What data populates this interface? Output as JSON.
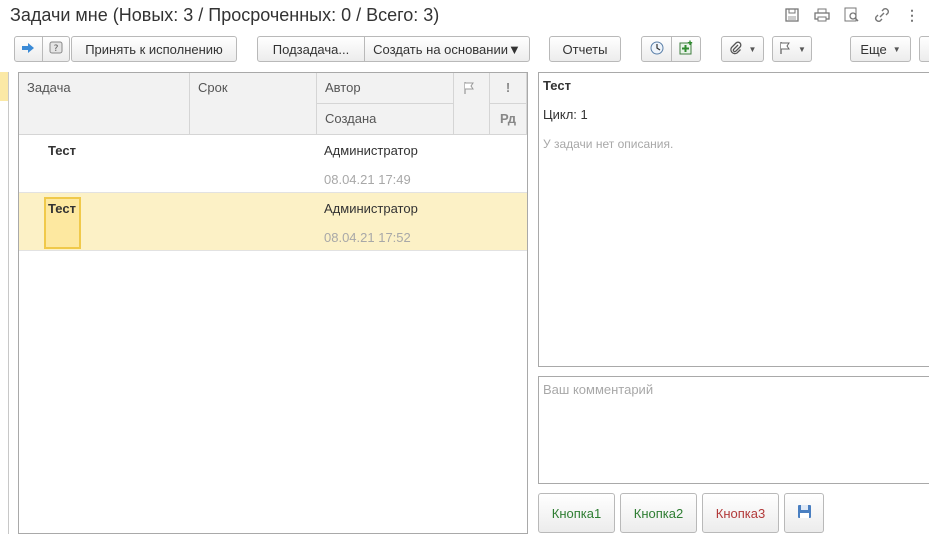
{
  "window": {
    "title": "Задачи мне (Новых: 3 / Просроченных: 0 / Всего: 3)"
  },
  "toolbar": {
    "accept_label": "Принять к исполнению",
    "subtask_label": "Подзадача...",
    "create_based_label": "Создать на основании",
    "reports_label": "Отчеты",
    "more_label": "Еще"
  },
  "table": {
    "headers": {
      "task": "Задача",
      "deadline": "Срок",
      "author": "Автор",
      "created": "Создана",
      "importance": "!",
      "rd": "Рд"
    },
    "rows": [
      {
        "task": "Тест",
        "deadline": "",
        "author": "Администратор",
        "created": "08.04.21 17:49"
      },
      {
        "task": "Тест",
        "deadline": "",
        "author": "Администратор",
        "created": "08.04.21 17:52"
      }
    ]
  },
  "details": {
    "title": "Тест",
    "cycle_label": "Цикл:",
    "cycle_value": "1",
    "no_description": "У задачи нет описания."
  },
  "comment": {
    "placeholder": "Ваш комментарий"
  },
  "action_buttons": [
    {
      "label": "Кнопка1",
      "color": "#2e7d32"
    },
    {
      "label": "Кнопка2",
      "color": "#2e7d32"
    },
    {
      "label": "Кнопка3",
      "color": "#b23a3a"
    }
  ]
}
